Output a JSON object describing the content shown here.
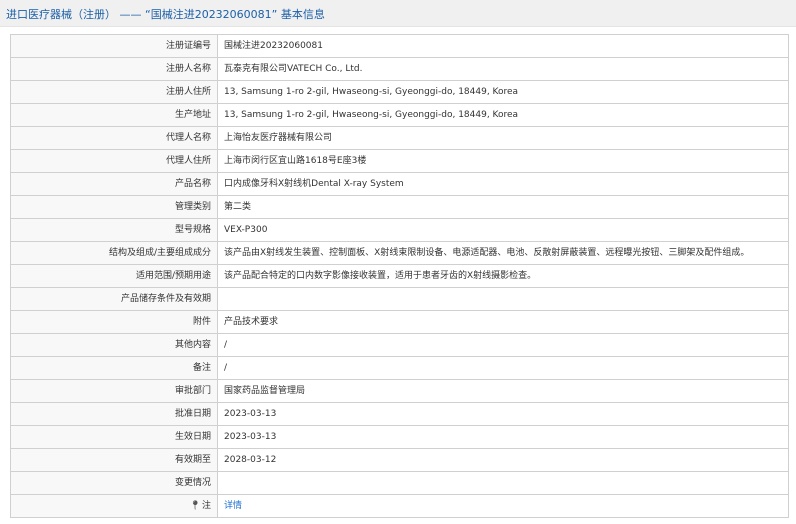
{
  "header": {
    "title": "进口医疗器械（注册） —— “国械注进20232060081” 基本信息"
  },
  "fields": [
    {
      "label": "注册证编号",
      "value": "国械注进20232060081"
    },
    {
      "label": "注册人名称",
      "value": "瓦泰克有限公司VATECH Co., Ltd."
    },
    {
      "label": "注册人住所",
      "value": "13, Samsung 1-ro 2-gil, Hwaseong-si, Gyeonggi-do, 18449, Korea"
    },
    {
      "label": "生产地址",
      "value": "13, Samsung 1-ro 2-gil, Hwaseong-si, Gyeonggi-do, 18449, Korea"
    },
    {
      "label": "代理人名称",
      "value": "上海怡友医疗器械有限公司"
    },
    {
      "label": "代理人住所",
      "value": "上海市闵行区宜山路1618号E座3楼"
    },
    {
      "label": "产品名称",
      "value": "口内成像牙科X射线机Dental X-ray System"
    },
    {
      "label": "管理类别",
      "value": "第二类"
    },
    {
      "label": "型号规格",
      "value": "VEX-P300"
    },
    {
      "label": "结构及组成/主要组成成分",
      "value": "该产品由X射线发生装置、控制面板、X射线束限制设备、电源适配器、电池、反散射屏蔽装置、远程曝光按钮、三脚架及配件组成。"
    },
    {
      "label": "适用范围/预期用途",
      "value": "该产品配合特定的口内数字影像接收装置，适用于患者牙齿的X射线摄影检查。"
    },
    {
      "label": "产品储存条件及有效期",
      "value": ""
    },
    {
      "label": "附件",
      "value": "产品技术要求"
    },
    {
      "label": "其他内容",
      "value": "/"
    },
    {
      "label": "备注",
      "value": "/"
    },
    {
      "label": "审批部门",
      "value": "国家药品监督管理局"
    },
    {
      "label": "批准日期",
      "value": "2023-03-13"
    },
    {
      "label": "生效日期",
      "value": "2023-03-13"
    },
    {
      "label": "有效期至",
      "value": "2028-03-12"
    },
    {
      "label": "变更情况",
      "value": ""
    }
  ],
  "footer_row": {
    "label": "注",
    "icon": "pin-icon",
    "link_text": "详情"
  },
  "colors": {
    "header_text": "#1b5fa8",
    "link": "#1b6fd0",
    "border": "#d0d0d0"
  }
}
